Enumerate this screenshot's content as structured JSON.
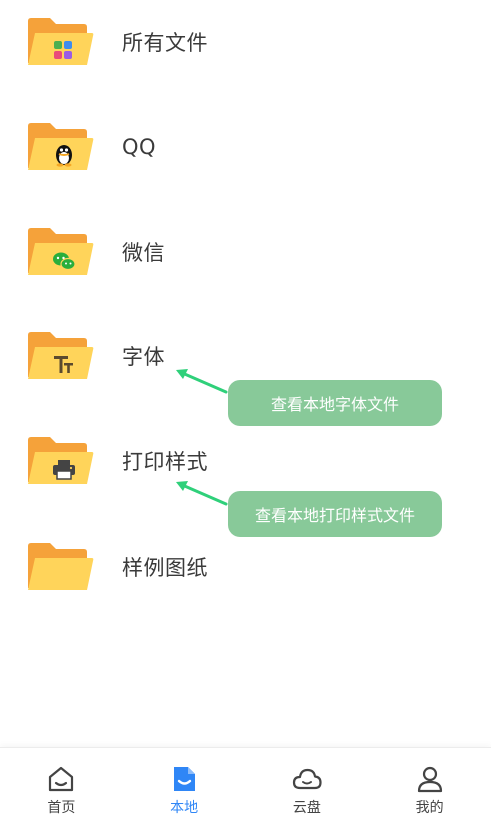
{
  "folders": [
    {
      "label": "所有文件",
      "icon": "apps-grid-icon"
    },
    {
      "label": "QQ",
      "icon": "qq-penguin-icon"
    },
    {
      "label": "微信",
      "icon": "wechat-icon"
    },
    {
      "label": "字体",
      "icon": "font-tt-icon"
    },
    {
      "label": "打印样式",
      "icon": "printer-icon"
    },
    {
      "label": "样例图纸",
      "icon": "blank-folder-icon"
    }
  ],
  "callouts": {
    "fonts": "查看本地字体文件",
    "print_styles": "查看本地打印样式文件"
  },
  "tabbar": {
    "items": [
      {
        "label": "首页",
        "icon": "home-icon",
        "active": false
      },
      {
        "label": "本地",
        "icon": "local-file-icon",
        "active": true
      },
      {
        "label": "云盘",
        "icon": "cloud-icon",
        "active": false
      },
      {
        "label": "我的",
        "icon": "person-icon",
        "active": false
      }
    ]
  },
  "colors": {
    "folder_back": "#f5a23a",
    "folder_front": "#ffd45a",
    "callout": "#88c999",
    "arrow": "#2fd07a",
    "active_tab": "#2f86f6"
  }
}
